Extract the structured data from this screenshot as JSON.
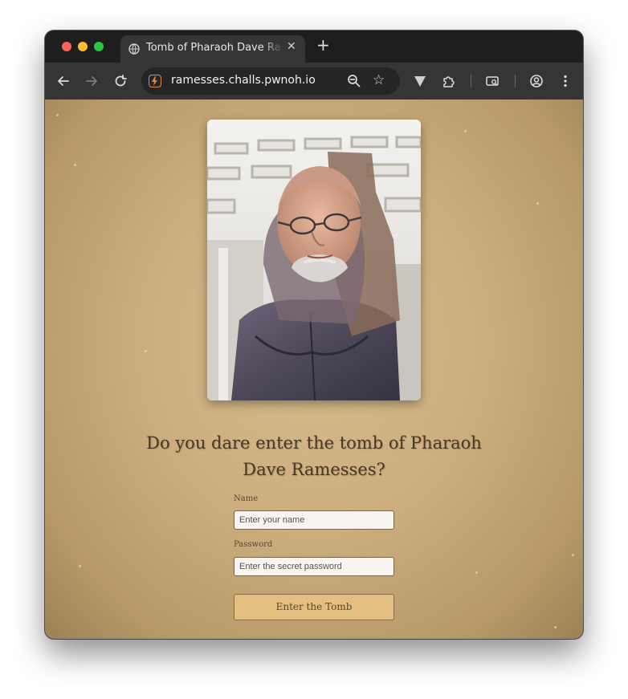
{
  "browser": {
    "tab_title": "Tomb of Pharaoh Dave Ramesses",
    "url": "ramesses.challs.pwnoh.io",
    "icons": [
      "back-icon",
      "forward-icon",
      "reload-icon",
      "site-info-icon",
      "zoom-icon",
      "star-icon",
      "vivaldi-icon",
      "extensions-icon",
      "tab-search-icon",
      "profile-icon",
      "menu-icon",
      "globe-icon",
      "close-icon",
      "plus-icon"
    ]
  },
  "page": {
    "heading": "Do you dare enter the tomb of Pharaoh Dave Ramesses?",
    "name_label": "Name",
    "name_placeholder": "Enter your name",
    "password_label": "Password",
    "password_placeholder": "Enter the secret password",
    "submit_label": "Enter the Tomb",
    "colors": {
      "background": "#ccae7e",
      "button": "#e3c07d",
      "text": "#4a3826"
    }
  }
}
